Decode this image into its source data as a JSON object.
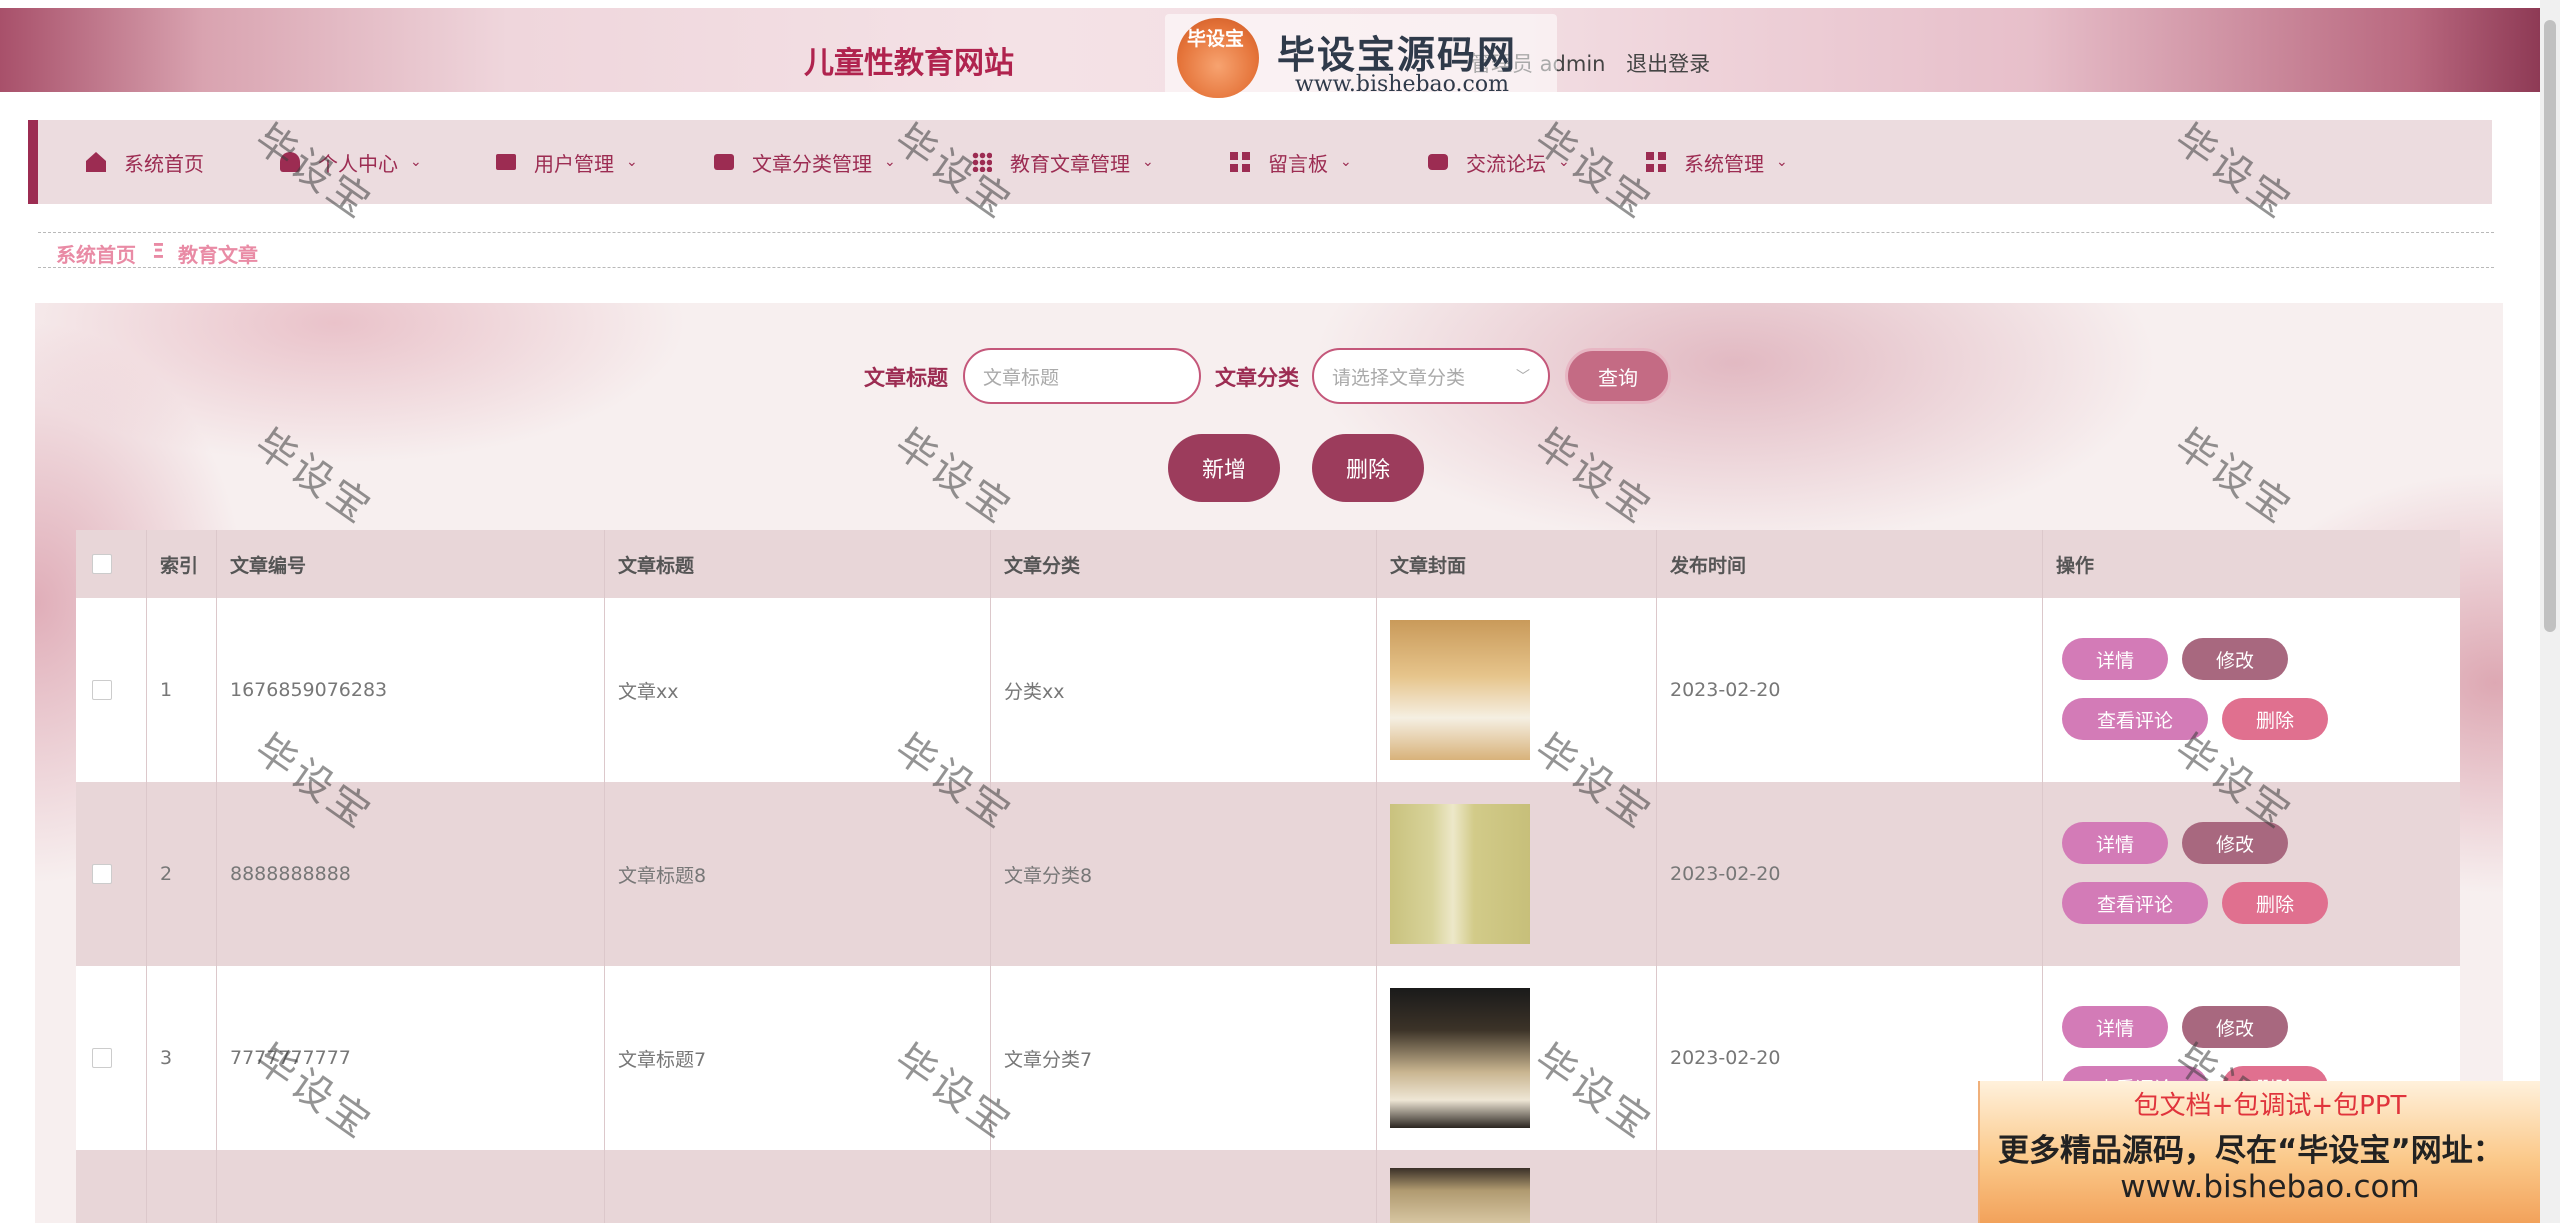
{
  "header": {
    "site_title": "儿童性教育网站",
    "user_label": "管理员 admin",
    "logout": "退出登录",
    "logo_badge": "毕设宝",
    "logo_main": "毕设宝源码网",
    "logo_url": "www.bishebao.com"
  },
  "nav": {
    "items": [
      {
        "label": "系统首页",
        "icon": "home-icon"
      },
      {
        "label": "个人中心",
        "icon": "person-icon"
      },
      {
        "label": "用户管理",
        "icon": "monitor-icon"
      },
      {
        "label": "文章分类管理",
        "icon": "briefcase-icon"
      },
      {
        "label": "教育文章管理",
        "icon": "grid-icon"
      },
      {
        "label": "留言板",
        "icon": "grid-icon"
      },
      {
        "label": "交流论坛",
        "icon": "chat-icon"
      },
      {
        "label": "系统管理",
        "icon": "grid-icon"
      }
    ]
  },
  "breadcrumb": {
    "home": "系统首页",
    "sep": "Ξ",
    "current": "教育文章"
  },
  "search": {
    "title_label": "文章标题",
    "title_placeholder": "文章标题",
    "category_label": "文章分类",
    "category_placeholder": "请选择文章分类",
    "query_button": "查询"
  },
  "actions": {
    "add": "新增",
    "delete": "删除"
  },
  "table": {
    "headers": [
      "索引",
      "文章编号",
      "文章标题",
      "文章分类",
      "文章封面",
      "发布时间",
      "操作"
    ],
    "rows": [
      {
        "index": "1",
        "code": "1676859076283",
        "title": "文章xx",
        "category": "分类xx",
        "date": "2023-02-20"
      },
      {
        "index": "2",
        "code": "8888888888",
        "title": "文章标题8",
        "category": "文章分类8",
        "date": "2023-02-20"
      },
      {
        "index": "3",
        "code": "7777777777",
        "title": "文章标题7",
        "category": "文章分类7",
        "date": "2023-02-20"
      },
      {
        "index": "",
        "code": "",
        "title": "",
        "category": "",
        "date": ""
      }
    ],
    "row_buttons": {
      "detail": "详情",
      "edit": "修改",
      "comment": "查看评论",
      "remove": "删除"
    }
  },
  "watermark": "毕设宝",
  "ad": {
    "line1": "包文档+包调试+包PPT",
    "line2": "更多精品源码，尽在“毕设宝”网址：",
    "line3": "www.bishebao.com"
  },
  "colors": {
    "accent": "#9c2c52",
    "breadcrumb": "#e98ba5",
    "header_row": "#e8d6d8"
  }
}
